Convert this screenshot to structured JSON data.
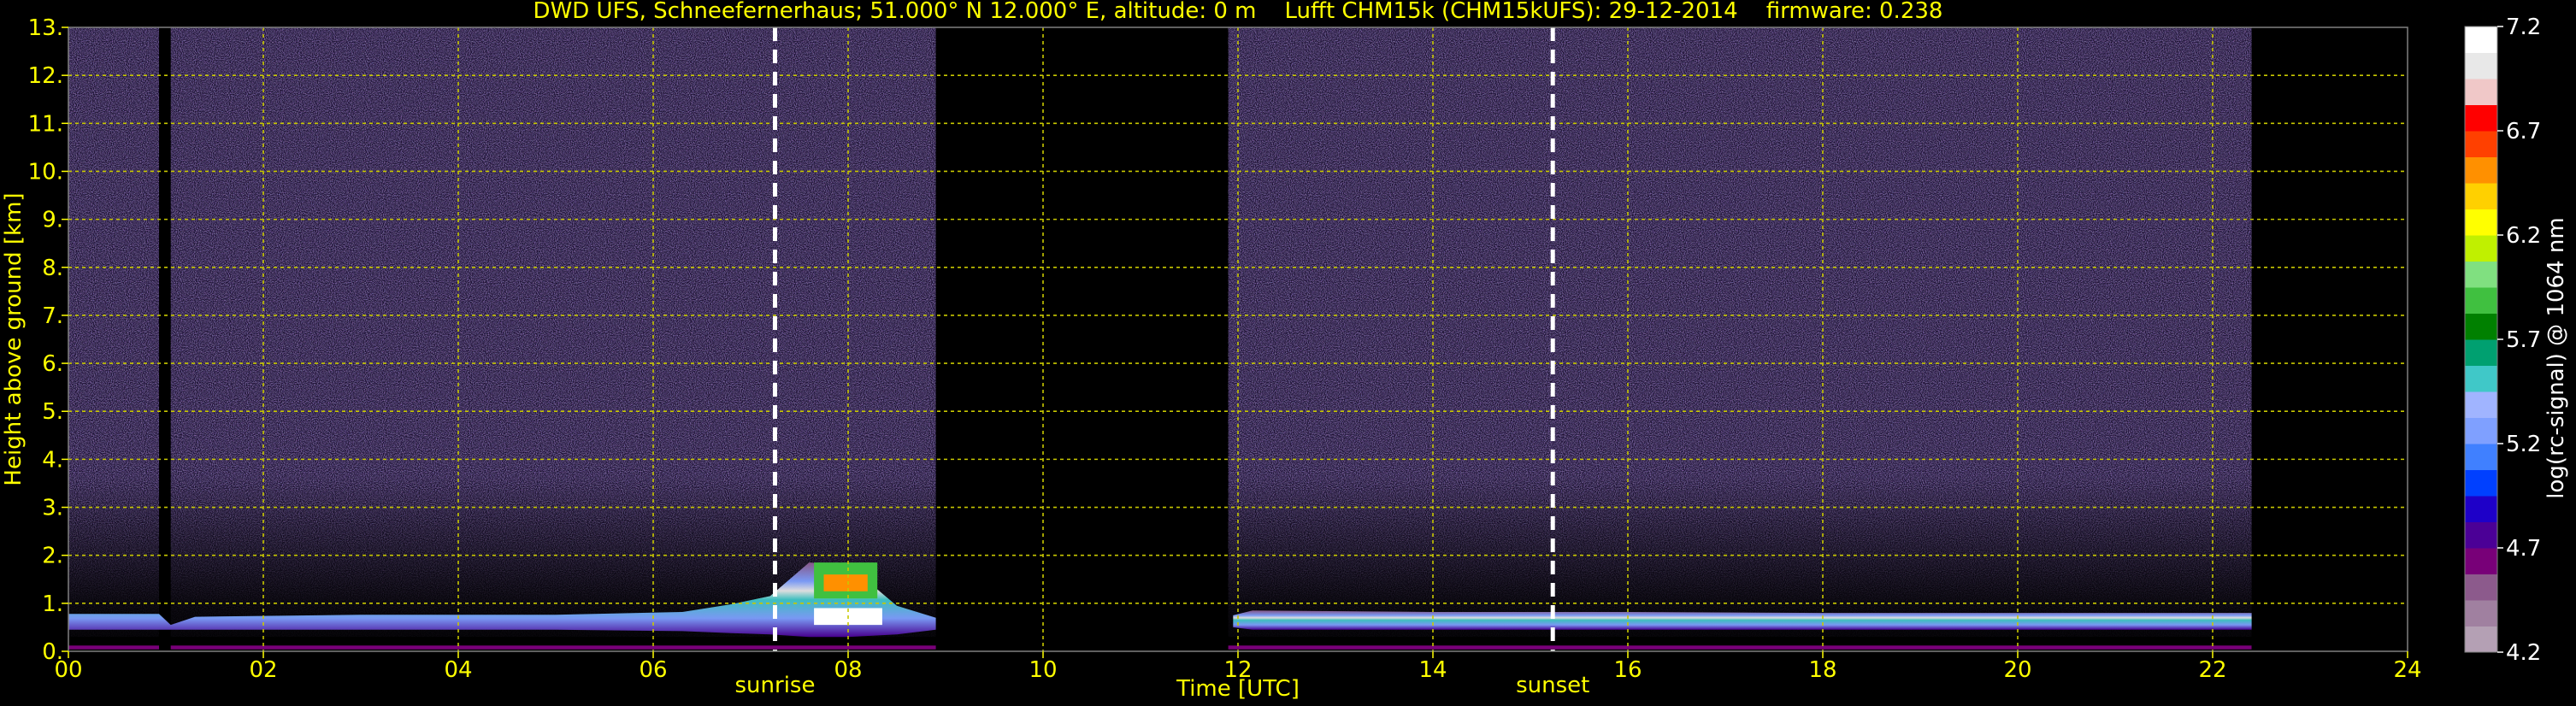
{
  "chart_data": {
    "type": "heatmap",
    "title": "DWD UFS, Schneefernerhaus; 51.000° N 12.000° E, altitude: 0 m    Lufft CHM15k (CHM15kUFS): 29-12-2014    firmware: 0.238",
    "xlabel": "Time [UTC]",
    "ylabel": "Height above ground [km]",
    "xlim": [
      0,
      24
    ],
    "ylim": [
      0,
      13
    ],
    "x_ticks": [
      0,
      2,
      4,
      6,
      8,
      10,
      12,
      14,
      16,
      18,
      20,
      22,
      24
    ],
    "x_tick_labels": [
      "00",
      "02",
      "04",
      "06",
      "08",
      "10",
      "12",
      "14",
      "16",
      "18",
      "20",
      "22",
      "24"
    ],
    "y_ticks": [
      0,
      1,
      2,
      3,
      4,
      5,
      6,
      7,
      8,
      9,
      10,
      11,
      12,
      13
    ],
    "y_tick_labels": [
      "0.",
      "1.",
      "2.",
      "3.",
      "4.",
      "5.",
      "6.",
      "7.",
      "8.",
      "9.",
      "10.",
      "11.",
      "12.",
      "13."
    ],
    "grid": true,
    "markers": [
      {
        "label": "sunrise",
        "x": 7.25
      },
      {
        "label": "sunset",
        "x": 15.23
      }
    ],
    "data_gaps": [
      [
        0.93,
        1.05
      ],
      [
        8.9,
        11.9
      ],
      [
        22.4,
        24
      ]
    ],
    "aerosol_layer": [
      {
        "x": 0.0,
        "base": 0.45,
        "top": 0.78
      },
      {
        "x": 0.93,
        "base": 0.45,
        "top": 0.78
      },
      {
        "x": 1.05,
        "base": 0.45,
        "top": 0.55
      },
      {
        "x": 1.3,
        "base": 0.45,
        "top": 0.72
      },
      {
        "x": 3.0,
        "base": 0.45,
        "top": 0.76
      },
      {
        "x": 5.0,
        "base": 0.45,
        "top": 0.76
      },
      {
        "x": 6.3,
        "base": 0.42,
        "top": 0.82
      },
      {
        "x": 6.8,
        "base": 0.38,
        "top": 0.98
      },
      {
        "x": 7.2,
        "base": 0.35,
        "top": 1.15
      },
      {
        "x": 7.6,
        "base": 0.3,
        "top": 1.85
      },
      {
        "x": 8.0,
        "base": 0.3,
        "top": 1.8
      },
      {
        "x": 8.5,
        "base": 0.35,
        "top": 0.95
      },
      {
        "x": 8.9,
        "base": 0.45,
        "top": 0.7
      },
      {
        "x": 11.95,
        "base": 0.5,
        "top": 0.75
      },
      {
        "x": 12.15,
        "base": 0.45,
        "top": 0.85
      },
      {
        "x": 14.0,
        "base": 0.45,
        "top": 0.82
      },
      {
        "x": 16.0,
        "base": 0.45,
        "top": 0.82
      },
      {
        "x": 18.0,
        "base": 0.45,
        "top": 0.8
      },
      {
        "x": 20.0,
        "base": 0.45,
        "top": 0.8
      },
      {
        "x": 22.4,
        "base": 0.45,
        "top": 0.8
      }
    ],
    "colorbar": {
      "label": "log(rc-signal) @ 1064 nm",
      "range": [
        4.2,
        7.2
      ],
      "ticks": [
        4.2,
        4.7,
        5.2,
        5.7,
        6.2,
        6.7,
        7.2
      ],
      "tick_labels": [
        "4.2",
        "4.7",
        "5.2",
        "5.7",
        "6.2",
        "6.7",
        "7.2"
      ],
      "colors": [
        "#b4a0b4",
        "#a080a0",
        "#8c5a8c",
        "#780078",
        "#4b0096",
        "#1e00c8",
        "#0040ff",
        "#4080ff",
        "#7fa0ff",
        "#a0b4ff",
        "#40c8c8",
        "#00a070",
        "#008000",
        "#40c040",
        "#80e080",
        "#c0f000",
        "#ffff00",
        "#ffd000",
        "#ff9000",
        "#ff4000",
        "#ff0000",
        "#f0c8c8",
        "#e8e8e8",
        "#ffffff"
      ]
    },
    "colors": {
      "background": "#000000",
      "text": "#ffff00",
      "grid": "#c8c800",
      "frame": "#808080",
      "colorbar_text": "#ffffff"
    }
  }
}
